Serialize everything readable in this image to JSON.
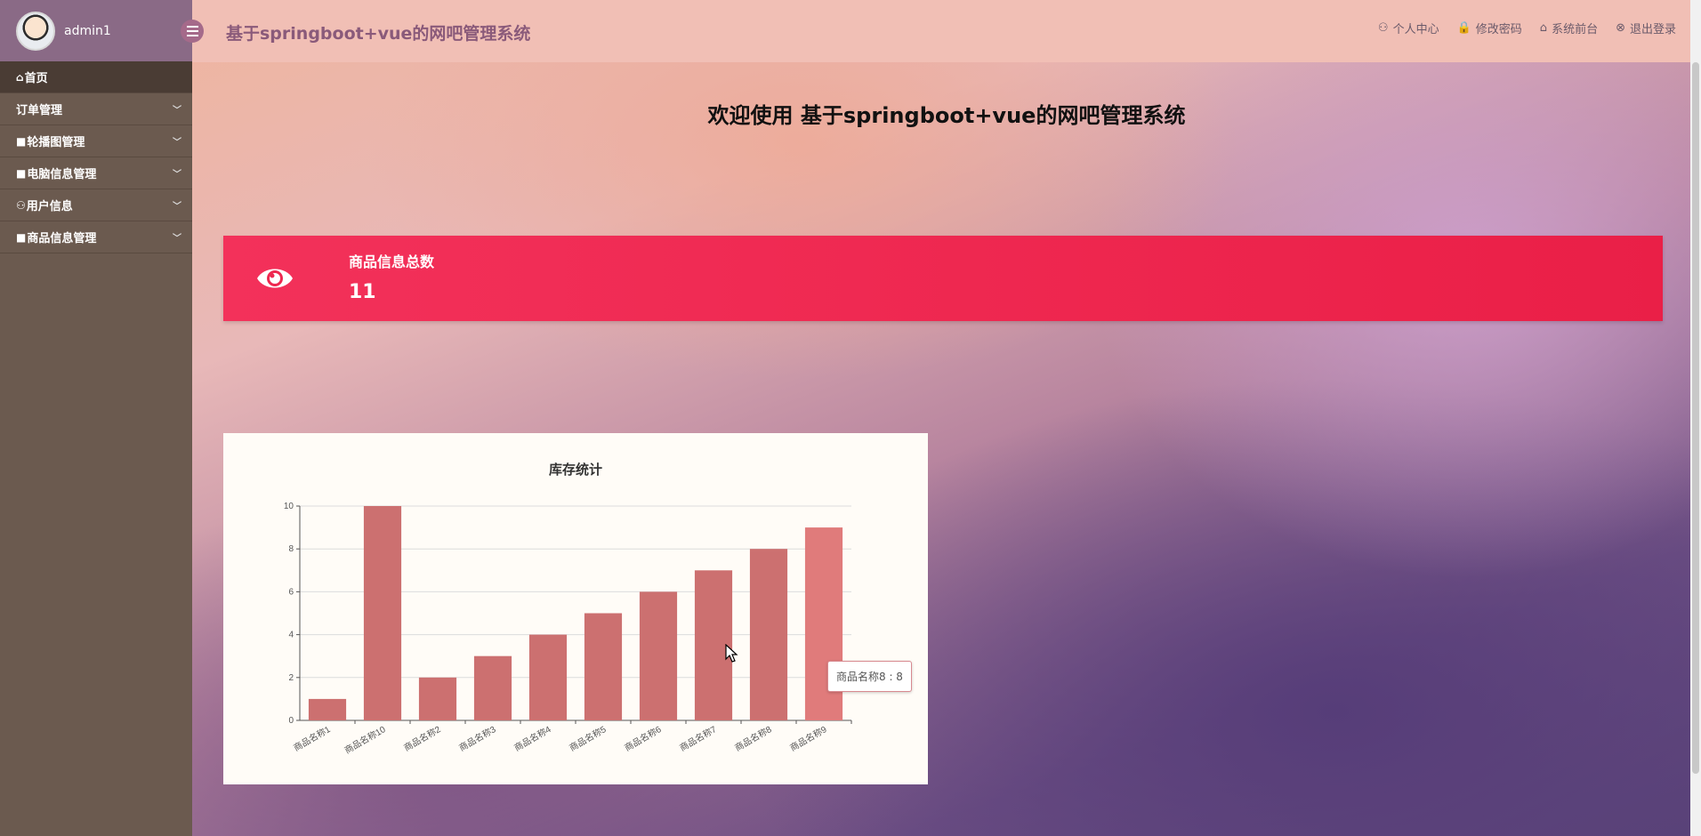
{
  "sidebar": {
    "user": "admin1",
    "items": [
      {
        "icon": "⌂",
        "label": "首页"
      },
      {
        "icon": "",
        "label": "订单管理"
      },
      {
        "icon": "■",
        "label": "轮播图管理"
      },
      {
        "icon": "■",
        "label": "电脑信息管理"
      },
      {
        "icon": "⚇",
        "label": "用户信息"
      },
      {
        "icon": "■",
        "label": "商品信息管理"
      }
    ]
  },
  "header": {
    "title": "基于springboot+vue的网吧管理系统",
    "links": [
      {
        "icon": "⚇",
        "label": "个人中心"
      },
      {
        "icon": "🔒",
        "label": "修改密码"
      },
      {
        "icon": "⌂",
        "label": "系统前台"
      },
      {
        "icon": "⊗",
        "label": "退出登录"
      }
    ]
  },
  "main": {
    "welcome": "欢迎使用 基于springboot+vue的网吧管理系统",
    "stat": {
      "label": "商品信息总数",
      "value": "11"
    },
    "tooltip": "商品名称8 : 8"
  },
  "colors": {
    "stat_card": "#f3315a",
    "bar": "#cc7070",
    "bar_highlight": "#e07b7b",
    "sidebar": "#6b5a4f",
    "topbar": "#f1bfb5"
  },
  "chart_data": {
    "type": "bar",
    "title": "库存统计",
    "categories": [
      "商品名称1",
      "商品名称10",
      "商品名称2",
      "商品名称3",
      "商品名称4",
      "商品名称5",
      "商品名称6",
      "商品名称7",
      "商品名称8",
      "商品名称9"
    ],
    "values": [
      1,
      10,
      2,
      3,
      4,
      5,
      6,
      7,
      8,
      9
    ],
    "ylim": [
      0,
      10
    ],
    "yticks": [
      0,
      2,
      4,
      6,
      8,
      10
    ],
    "xlabel": "",
    "ylabel": "",
    "grid": true,
    "highlight_index": 9
  }
}
